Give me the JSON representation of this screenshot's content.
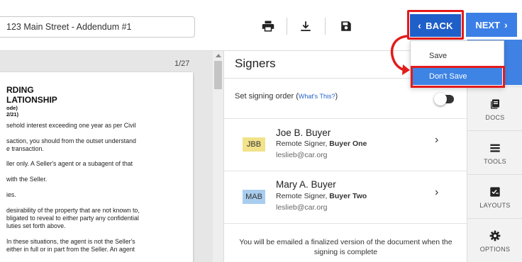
{
  "toolbar": {
    "document_name": "123 Main Street - Addendum #1",
    "print_icon": "print-icon",
    "download_icon": "download-icon",
    "save_icon": "floppy-disk-icon",
    "back_label": "BACK",
    "next_label": "NEXT"
  },
  "dropdown": {
    "save_label": "Save",
    "dont_save_label": "Don't Save"
  },
  "document": {
    "page_counter": "1/27",
    "heading_line1": "RDING",
    "heading_line2": "LATIONSHIP",
    "code_line": "ode)",
    "date_line": "2/21)",
    "lines": [
      "sehold interest exceeding one year as per Civil",
      "saction, you should from the outset understand",
      "e transaction.",
      "ller only. A Seller's agent or a subagent of that",
      "with the Seller.",
      "ies.",
      "desirability of the property that are not known to,",
      "bligated to reveal to either party any confidential",
      "luties set forth above.",
      "In these situations, the agent is not the Seller's",
      "either in full or in part from the Seller. An agent"
    ]
  },
  "signers_panel": {
    "title": "Signers",
    "order_label": "Set signing order (",
    "whats_this": "What's This?",
    "order_label_end": ")",
    "signers": [
      {
        "initials": "JBB",
        "name": "Joe B. Buyer",
        "role_prefix": "Remote Signer, ",
        "role": "Buyer One",
        "email": "leslieb@car.org",
        "badge_color": "#f2e28a"
      },
      {
        "initials": "MAB",
        "name": "Mary A. Buyer",
        "role_prefix": "Remote Signer, ",
        "role": "Buyer Two",
        "email": "leslieb@car.org",
        "badge_color": "#a9cdef"
      }
    ],
    "notice_line1": "You will be emailed a finalized version of the document when the",
    "notice_line2": "signing is complete"
  },
  "rail": {
    "items": [
      {
        "label": "DOCS",
        "icon": "documents-icon"
      },
      {
        "label": "TOOLS",
        "icon": "tools-icon"
      },
      {
        "label": "LAYOUTS",
        "icon": "layouts-icon"
      },
      {
        "label": "OPTIONS",
        "icon": "options-gear-icon"
      }
    ]
  },
  "colors": {
    "back_button": "#1f5fc9",
    "next_button": "#3b7fe6",
    "highlight": "#e31b1b",
    "active_rail": "#3f82e3"
  }
}
